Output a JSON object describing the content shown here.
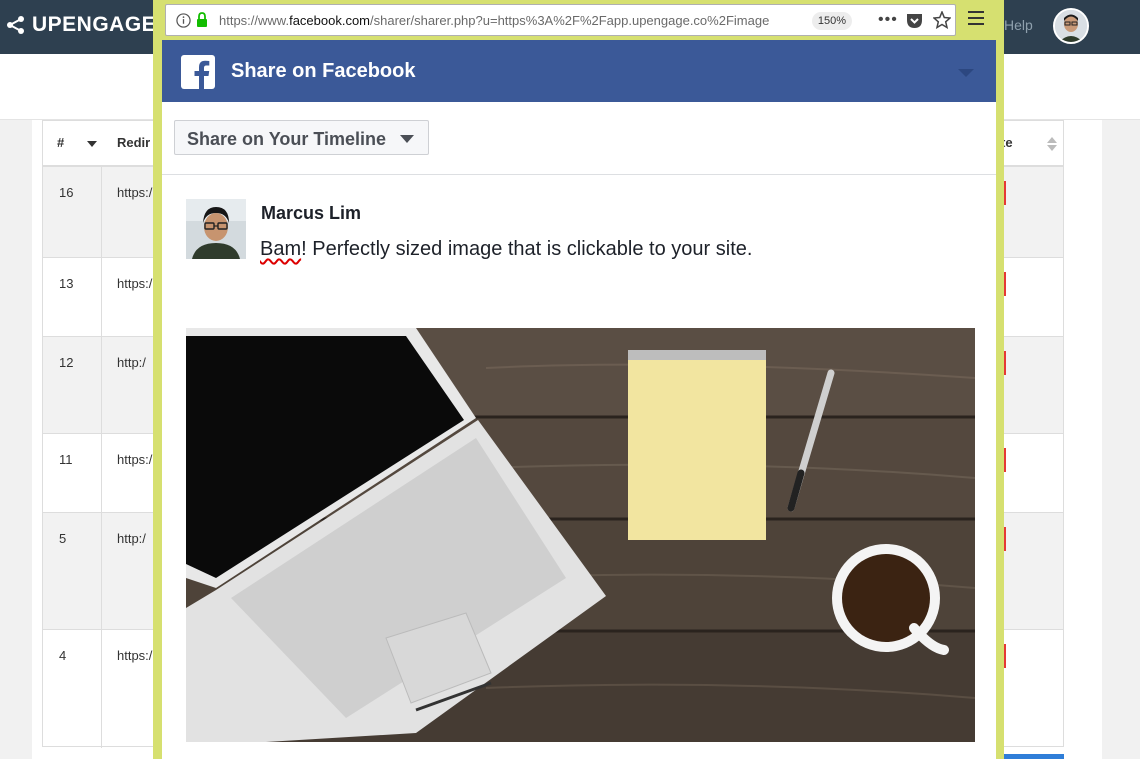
{
  "app": {
    "brand": "UPENGAGE",
    "help_label": "Help"
  },
  "table": {
    "headers": {
      "num": "#",
      "redirect": "Redir",
      "date": "te"
    },
    "rows": [
      {
        "num": "16",
        "url": "https:/"
      },
      {
        "num": "13",
        "url": "https:/"
      },
      {
        "num": "12",
        "url": "http:/"
      },
      {
        "num": "11",
        "url": "https:/"
      },
      {
        "num": "5",
        "url": "http:/"
      },
      {
        "num": "4",
        "url": "https:/"
      }
    ]
  },
  "browser": {
    "url_prefix": "https://www.",
    "url_domain": "facebook.com",
    "url_rest": "/sharer/sharer.php?u=https%3A%2F%2Fapp.upengage.co%2Fimage",
    "zoom": "150%"
  },
  "facebook": {
    "header_title": "Share on Facebook",
    "share_target": "Share on Your Timeline",
    "author": "Marcus Lim",
    "message_spell": "Bam",
    "message_rest": "! Perfectly sized image that is clickable to your site."
  },
  "colors": {
    "topbar": "#2e4050",
    "facebook_blue": "#3b5998",
    "popup_border": "#d6e070"
  }
}
